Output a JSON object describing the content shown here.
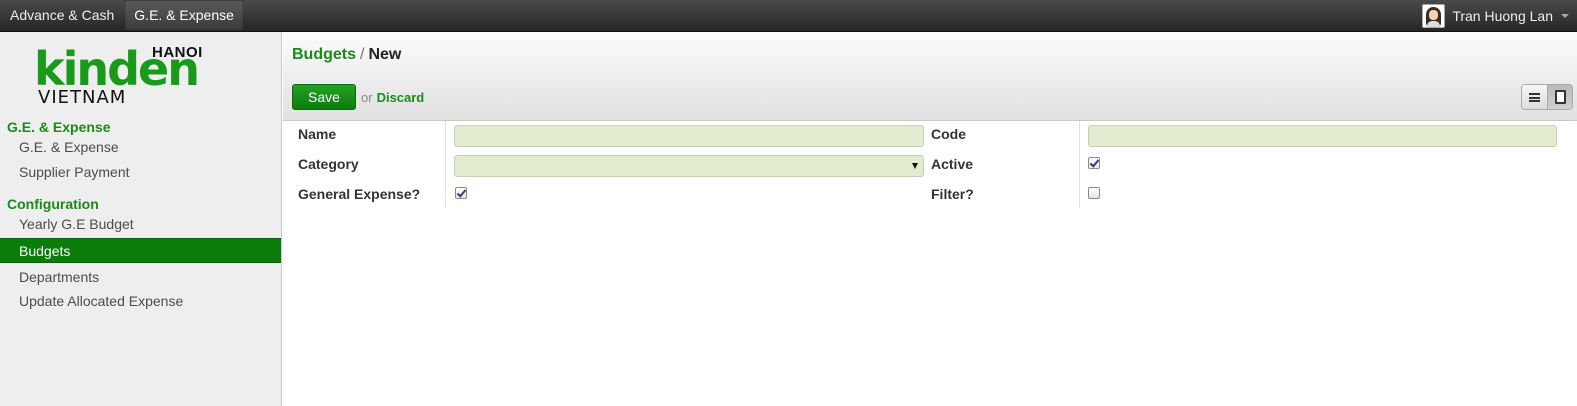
{
  "topbar": {
    "menu": [
      {
        "label": "Advance & Cash"
      },
      {
        "label": "G.E. & Expense"
      }
    ],
    "user_name": "Tran Huong Lan"
  },
  "logo": {
    "city": "HANOI",
    "brand": "kinden",
    "country": "VIETNAM"
  },
  "sidebar": {
    "sections": [
      {
        "title": "G.E. & Expense",
        "items": [
          {
            "label": "G.E. & Expense"
          },
          {
            "label": "Supplier Payment"
          }
        ]
      },
      {
        "title": "Configuration",
        "items": [
          {
            "label": "Yearly G.E Budget"
          },
          {
            "label": "Budgets"
          },
          {
            "label": "Departments"
          },
          {
            "label": "Update Allocated Expense"
          }
        ]
      }
    ]
  },
  "header": {
    "breadcrumb_link": "Budgets",
    "breadcrumb_sep": "/",
    "breadcrumb_current": "New",
    "save_label": "Save",
    "or_label": "or",
    "discard_label": "Discard"
  },
  "form": {
    "name_label": "Name",
    "name_value": "",
    "code_label": "Code",
    "code_value": "",
    "category_label": "Category",
    "category_value": "",
    "active_label": "Active",
    "active_checked": true,
    "general_expense_label": "General Expense?",
    "general_expense_checked": true,
    "filter_label": "Filter?",
    "filter_checked": false
  },
  "colors": {
    "accent_green": "#1a8a1a",
    "active_nav_bg": "#0b7d0b",
    "input_bg": "#e2edd0",
    "topbar_bg": "#333333"
  }
}
